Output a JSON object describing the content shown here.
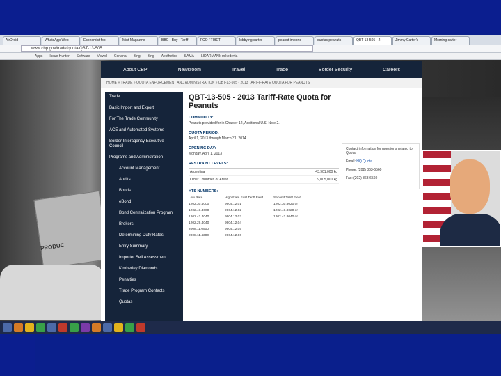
{
  "browser": {
    "tabs": [
      "AirDroid",
      "WhatsApp Web",
      "Economist foo",
      "Mint Magazine",
      "BBC - Buy - Tariff",
      "FCO / TIBET",
      "lobbying carter",
      "peanut imports",
      "quotas peanuts",
      "QBT-13-505 - 2",
      "Jimmy Carter's",
      "Morning carter"
    ],
    "active_tab": 9,
    "url": "www.cbp.gov/trade/quota/QBT-13-505",
    "bookmarks": [
      "Apps",
      "Issue Hunter",
      "Software",
      "Viewsl",
      "Cortana",
      "Bing",
      "Bing",
      "Aesthetics",
      "SAMA",
      "LIDARMANI: mikedevia"
    ]
  },
  "site": {
    "nav": [
      "About CBP",
      "Newsroom",
      "Travel",
      "Trade",
      "Border Security",
      "Careers"
    ],
    "breadcrumb": "HOME » TRADE » QUOTA ENFORCEMENT AND ADMINISTRATION » QBT-13-505 - 2013 TARIFF-RATE QUOTA FOR PEANUTS",
    "sidebar": [
      {
        "label": "Trade",
        "sub": false
      },
      {
        "label": "Basic Import and Export",
        "sub": false
      },
      {
        "label": "For The Trade Community",
        "sub": false
      },
      {
        "label": "ACE and Automated Systems",
        "sub": false
      },
      {
        "label": "Border Interagency Executive Council",
        "sub": false
      },
      {
        "label": "Programs and Administration",
        "sub": false
      },
      {
        "label": "Account Management",
        "sub": true
      },
      {
        "label": "Audits",
        "sub": true
      },
      {
        "label": "Bonds",
        "sub": true
      },
      {
        "label": "eBond",
        "sub": true
      },
      {
        "label": "Bond Centralization Program",
        "sub": true
      },
      {
        "label": "Brokers",
        "sub": true
      },
      {
        "label": "Determining Duty Rates",
        "sub": true
      },
      {
        "label": "Entry Summary",
        "sub": true
      },
      {
        "label": "Importer Self Assessment",
        "sub": true
      },
      {
        "label": "Kimberley Diamonds",
        "sub": true
      },
      {
        "label": "Penalties",
        "sub": true
      },
      {
        "label": "Trade Program Contacts",
        "sub": true
      },
      {
        "label": "Quotas",
        "sub": true
      }
    ],
    "title": "QBT-13-505 - 2013 Tariff-Rate Quota for Peanuts",
    "commodity_label": "COMMODITY:",
    "commodity_value": "Peanuts provided for in Chapter 12, Additional U.S. Note 2.",
    "quota_period_label": "QUOTA PERIOD:",
    "quota_period_value": "April 1, 2013 through March 31, 2014.",
    "opening_day_label": "OPENING DAY:",
    "opening_day_value": "Monday, April 1, 2013",
    "restraint_label": "RESTRAINT LEVELS:",
    "restraints": [
      {
        "country": "Argentina",
        "level": "43,901,000 kg"
      },
      {
        "country": "Other Countries or Areas",
        "level": "9,005,000 kg"
      }
    ],
    "hts_label": "HTS NUMBERS:",
    "hts_headers": [
      "Low Rate",
      "High Rate First Tariff Field",
      "Second Tariff Field"
    ],
    "hts_rows": [
      [
        "1202.30.4000",
        "9904.12.01",
        "1202.30.8020 or"
      ],
      [
        "1202.41.4000",
        "9904.12.02",
        "1202.41.8020 or"
      ],
      [
        "1202.41.4040",
        "9904.12.03",
        "1202.41.8040 or"
      ],
      [
        "1202.29.4040",
        "9904.12.04",
        ""
      ],
      [
        "2008.11.0500",
        "9904.12.05",
        ""
      ],
      [
        "2008.11.4300",
        "9904.12.06",
        ""
      ]
    ],
    "contact": {
      "heading": "Contact information for questions related to Quota:",
      "email_label": "Email:",
      "email_value": "HQ Quota",
      "phone": "Phone: (202) 863-6560",
      "fax": "Fax: (202) 863-6560"
    }
  },
  "photo": {
    "box_text": "PRODUC"
  }
}
